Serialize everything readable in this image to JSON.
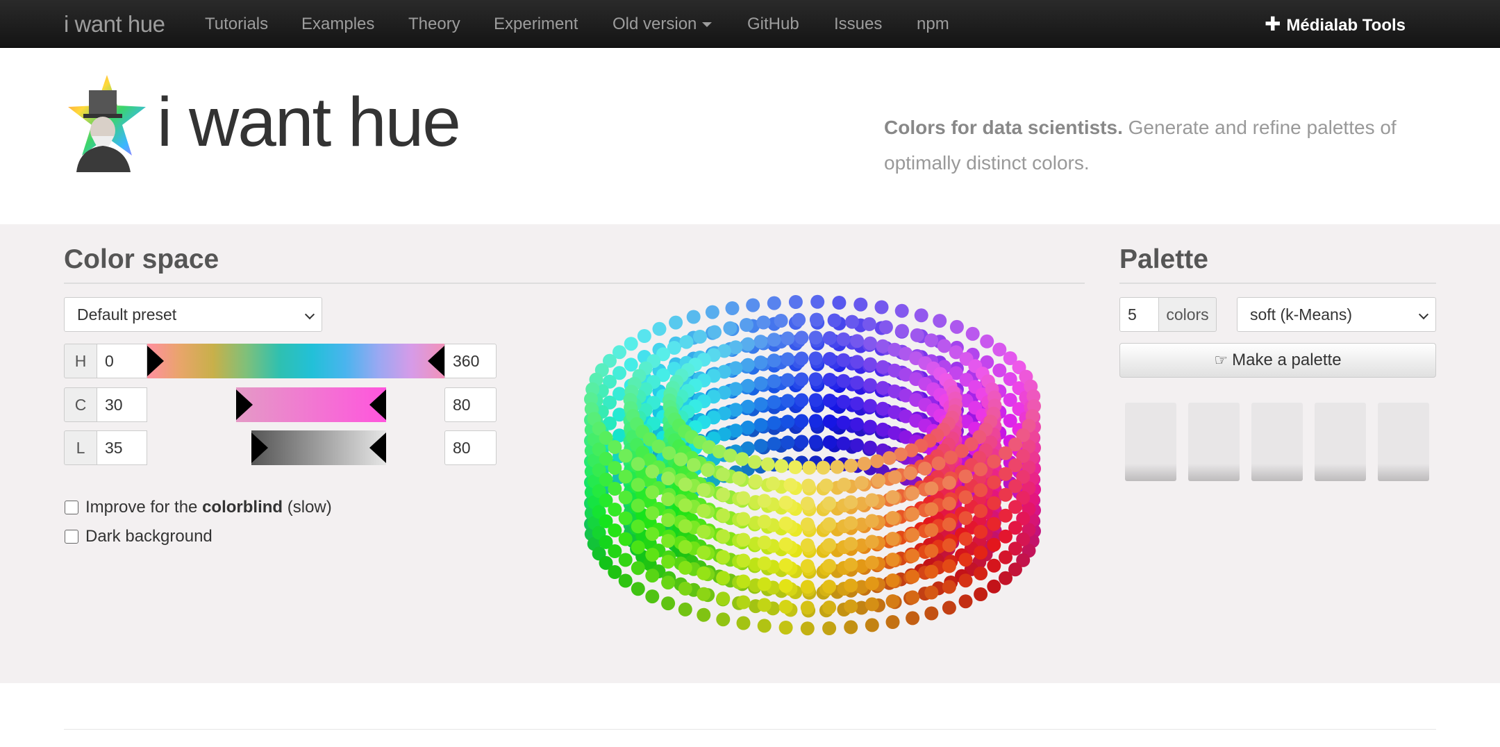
{
  "navbar": {
    "brand": "i want hue",
    "items": [
      "Tutorials",
      "Examples",
      "Theory",
      "Experiment",
      "Old version",
      "GitHub",
      "Issues",
      "npm"
    ],
    "tools_label": "Médialab Tools"
  },
  "header": {
    "title": "i want hue",
    "tagline_bold": "Colors for data scientists.",
    "tagline_rest": " Generate and refine palettes of optimally distinct colors."
  },
  "color_space": {
    "heading": "Color space",
    "preset": "Default preset",
    "h": {
      "label": "H",
      "min": "0",
      "max": "360"
    },
    "c": {
      "label": "C",
      "min": "30",
      "max": "80"
    },
    "l": {
      "label": "L",
      "min": "35",
      "max": "80"
    },
    "colorblind": {
      "pre": "Improve for the ",
      "bold": "colorblind",
      "post": " (slow)"
    },
    "dark_bg": "Dark background"
  },
  "palette": {
    "heading": "Palette",
    "count": "5",
    "count_unit": "colors",
    "mode": "soft (k-Means)",
    "make_button": "Make a palette",
    "swatch_count": 5
  },
  "icons": {
    "tools": "plus-icon",
    "make": "hand-pointer-icon",
    "select": "chevron-down-icon",
    "old_version": "caret-down-icon"
  },
  "colors": {
    "navbar_bg": "#1b1b1b",
    "nav_text": "#9d9d9d",
    "main_bg": "#f3f0f1"
  }
}
